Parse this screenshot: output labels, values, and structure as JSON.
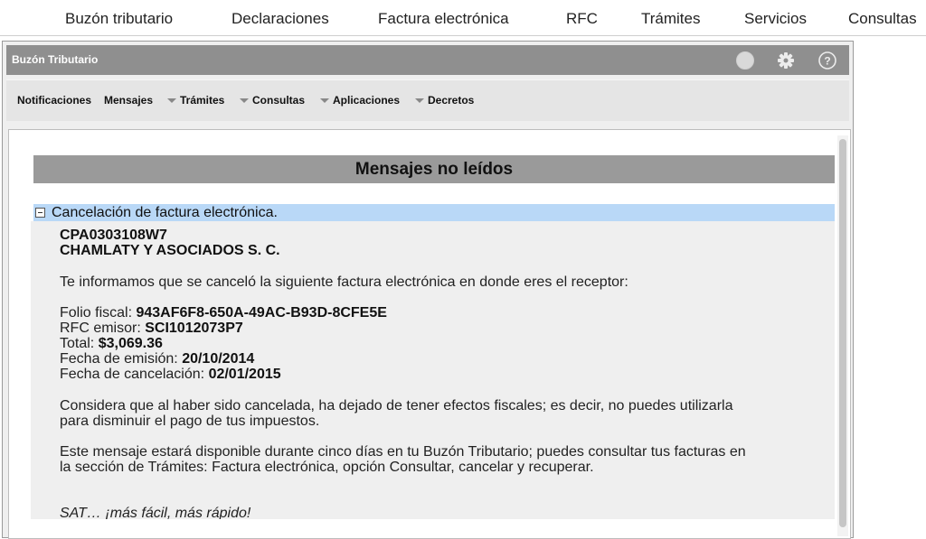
{
  "topnav": {
    "items": [
      "Buzón tributario",
      "Declaraciones",
      "Factura electrónica",
      "RFC",
      "Trámites",
      "Servicios",
      "Consultas"
    ]
  },
  "window": {
    "title": "Buzón Tributario",
    "icons": [
      "status-circle-icon",
      "gear-icon",
      "help-icon"
    ],
    "menu": {
      "items": [
        "Notificaciones",
        "Mensajes",
        "Trámites",
        "Consultas",
        "Aplicaciones",
        "Decretos"
      ]
    }
  },
  "content": {
    "header": "Mensajes no leídos",
    "message": {
      "subject": "Cancelación de factura electrónica.",
      "rfc": "CPA0303108W7",
      "company": "CHAMLATY Y ASOCIADOS S. C.",
      "intro": "Te informamos que se canceló la siguiente factura electrónica en donde eres el receptor:",
      "fields": {
        "folio_label": "Folio fiscal:",
        "folio_value": "943AF6F8-650A-49AC-B93D-8CFE5E",
        "rfc_emisor_label": "RFC emisor:",
        "rfc_emisor_value": "SCI1012073P7",
        "total_label": "Total:",
        "total_value": "$3,069.36",
        "emision_label": "Fecha de emisión:",
        "emision_value": "20/10/2014",
        "cancelacion_label": "Fecha de cancelación:",
        "cancelacion_value": "02/01/2015"
      },
      "para1_line1": "Considera que al haber sido cancelada, ha dejado de tener efectos fiscales; es decir, no puedes utilizarla",
      "para1_line2": "para disminuir el pago de tus impuestos.",
      "para2_line1": "Este mensaje estará disponible durante cinco días en tu Buzón Tributario; puedes consultar tus facturas en",
      "para2_line2": "la sección de Trámites: Factura electrónica, opción Consultar, cancelar y recuperar.",
      "signature": "SAT… ¡más fácil, más rápido!"
    }
  }
}
